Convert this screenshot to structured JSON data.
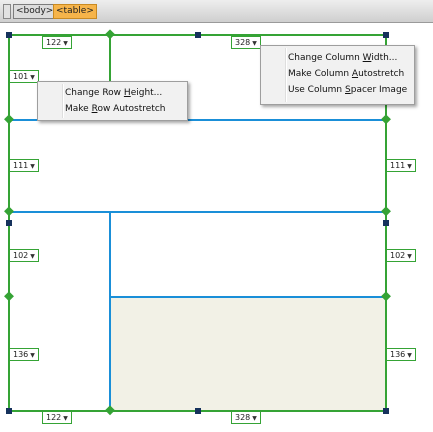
{
  "tag_selector": {
    "tags": [
      "<body>",
      "<table>"
    ]
  },
  "widths": {
    "top_left": "122",
    "top_right": "328",
    "bottom_left": "122",
    "bottom_right": "328"
  },
  "row_heights": {
    "row1": "101",
    "row2_left": "111",
    "row2_right": "111",
    "row3_left": "102",
    "row3_right": "102",
    "row4_left": "136",
    "row4_right": "136"
  },
  "row_menu": {
    "items": [
      {
        "pre": "Change Row ",
        "u": "H",
        "post": "eight..."
      },
      {
        "pre": "Make ",
        "u": "R",
        "post": "ow Autostretch"
      }
    ]
  },
  "column_menu": {
    "items": [
      {
        "pre": "Change Column ",
        "u": "W",
        "post": "idth..."
      },
      {
        "pre": "Make Column ",
        "u": "A",
        "post": "utostretch"
      },
      {
        "pre": "Use Column ",
        "u": "S",
        "post": "pacer Image"
      }
    ]
  },
  "colors": {
    "table_border": "#35a335",
    "cell_border": "#1a8fd8",
    "selected_cell": "#f2f1e6",
    "handle": "#16325c",
    "tag_selected": "#f6b44a"
  }
}
